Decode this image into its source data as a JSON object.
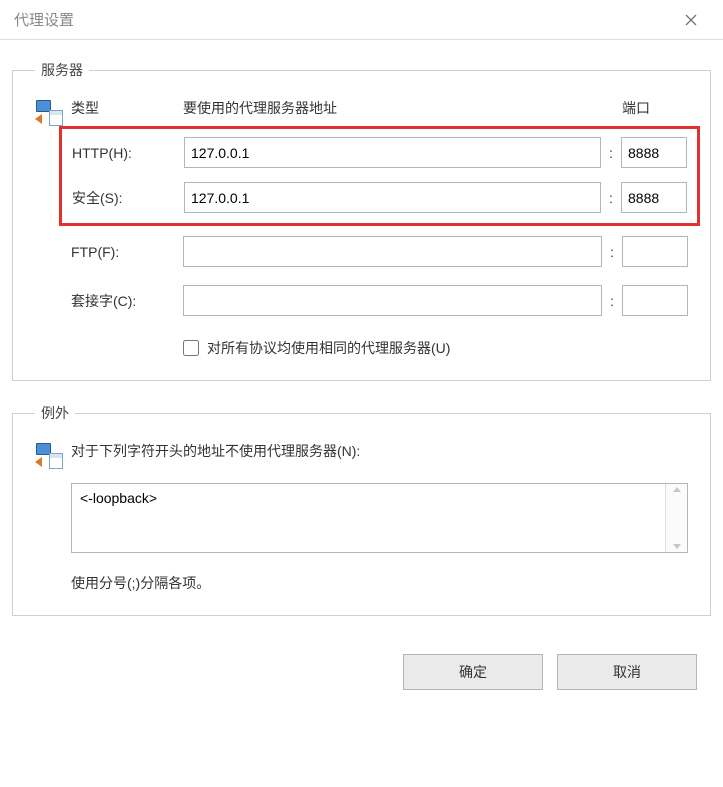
{
  "window": {
    "title": "代理设置"
  },
  "servers": {
    "legend": "服务器",
    "headers": {
      "type": "类型",
      "address": "要使用的代理服务器地址",
      "port": "端口"
    },
    "rows": {
      "http": {
        "label": "HTTP(H):",
        "address": "127.0.0.1",
        "port": "8888",
        "sep": ":"
      },
      "secure": {
        "label": "安全(S):",
        "address": "127.0.0.1",
        "port": "8888",
        "sep": ":"
      },
      "ftp": {
        "label": "FTP(F):",
        "address": "",
        "port": "",
        "sep": ":"
      },
      "socks": {
        "label": "套接字(C):",
        "address": "",
        "port": "",
        "sep": ":"
      }
    },
    "same_for_all": "对所有协议均使用相同的代理服务器(U)"
  },
  "exceptions": {
    "legend": "例外",
    "label": "对于下列字符开头的地址不使用代理服务器(N):",
    "value": "<-loopback>",
    "hint": "使用分号(;)分隔各项。"
  },
  "buttons": {
    "ok": "确定",
    "cancel": "取消"
  }
}
